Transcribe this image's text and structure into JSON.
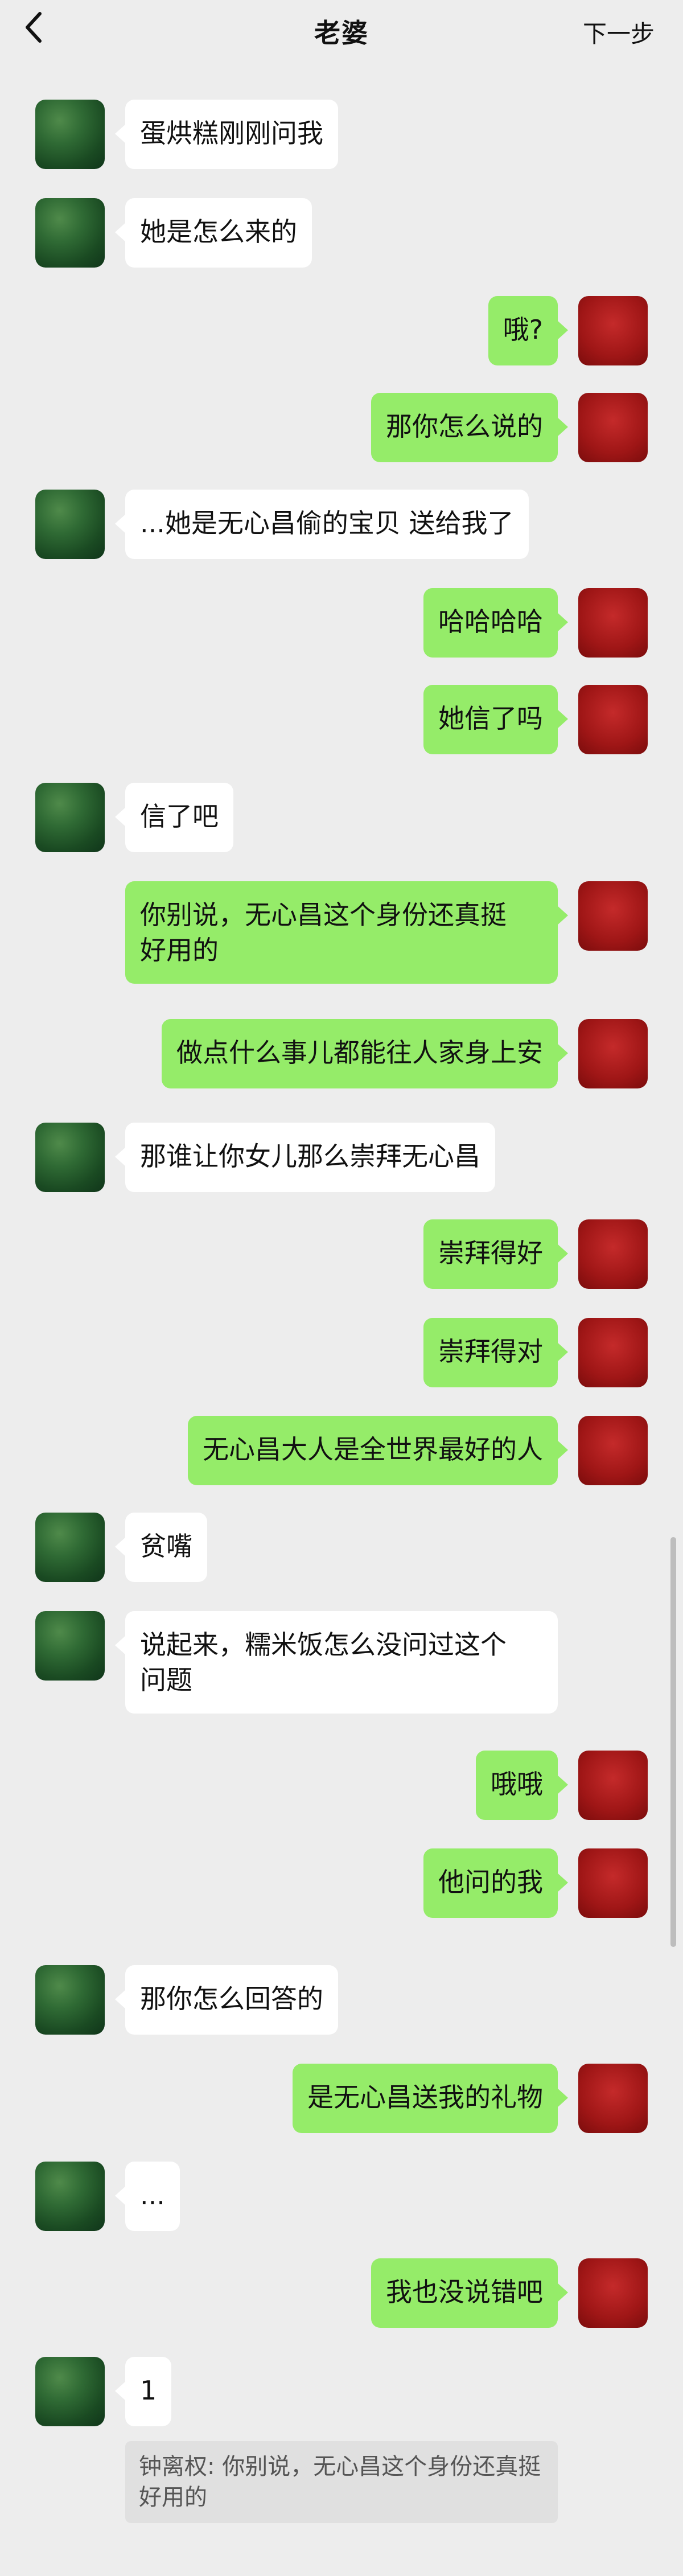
{
  "header": {
    "back_icon": "chevron-left-icon",
    "title": "老婆",
    "next_label": "下一步"
  },
  "messages": [
    {
      "side": "left",
      "text": "蛋烘糕刚刚问我"
    },
    {
      "side": "left",
      "text": "她是怎么来的"
    },
    {
      "side": "right",
      "text": "哦?"
    },
    {
      "side": "right",
      "text": "那你怎么说的"
    },
    {
      "side": "left",
      "text": "...她是无心昌偷的宝贝 送给我了"
    },
    {
      "side": "right",
      "text": "哈哈哈哈"
    },
    {
      "side": "right",
      "text": "她信了吗"
    },
    {
      "side": "left",
      "text": "信了吧"
    },
    {
      "side": "right",
      "text": "你别说，无心昌这个身份还真挺\n好用的"
    },
    {
      "side": "right",
      "text": "做点什么事儿都能往人家身上安"
    },
    {
      "side": "left",
      "text": "那谁让你女儿那么崇拜无心昌"
    },
    {
      "side": "right",
      "text": "崇拜得好"
    },
    {
      "side": "right",
      "text": "崇拜得对"
    },
    {
      "side": "right",
      "text": "无心昌大人是全世界最好的人"
    },
    {
      "side": "left",
      "text": "贫嘴"
    },
    {
      "side": "left",
      "text": "说起来，糯米饭怎么没问过这个\n问题"
    },
    {
      "side": "right",
      "text": "哦哦"
    },
    {
      "side": "right",
      "text": "他问的我"
    },
    {
      "side": "left",
      "text": "那你怎么回答的"
    },
    {
      "side": "right",
      "text": "是无心昌送我的礼物"
    },
    {
      "side": "left",
      "text": "..."
    },
    {
      "side": "right",
      "text": "我也没说错吧"
    },
    {
      "side": "left",
      "text": "1"
    }
  ],
  "quote": {
    "text": "钟离权: 你别说，无心昌这个身份还真挺好用的"
  },
  "colors": {
    "background": "#ededed",
    "self_bubble": "#95ec69",
    "other_bubble": "#ffffff"
  }
}
